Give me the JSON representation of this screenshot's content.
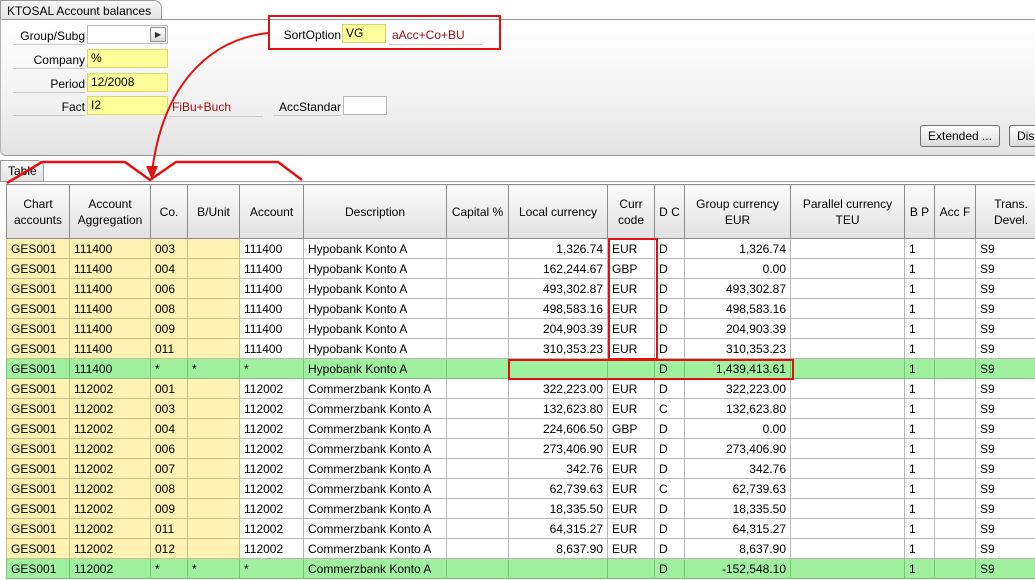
{
  "window": {
    "tab_title": "KTOSAL Account balances"
  },
  "form": {
    "group_subg": {
      "label": "Group/Subg",
      "value": ""
    },
    "company": {
      "label": "Company",
      "value": "%"
    },
    "period": {
      "label": "Period",
      "value": "12/2008"
    },
    "fact": {
      "label": "Fact",
      "value": "I2",
      "hint": "FiBu+Buch"
    },
    "sort_option": {
      "label": "SortOption",
      "value": "VG",
      "hint": "aAcc+Co+BU"
    },
    "acc_standard": {
      "label": "AccStandar",
      "value": ""
    },
    "buttons": {
      "extended": "Extended ...",
      "display": "Dis"
    }
  },
  "table": {
    "tab_label": "Table",
    "headers": [
      "Chart accounts",
      "Account Aggregation",
      "Co.",
      "B/Unit",
      "Account",
      "Description",
      "Capital %",
      "Local currency",
      "Curr code",
      "D C",
      "Group currency EUR",
      "Parallel currency TEU",
      "B P",
      "Acc F",
      "Trans. Devel."
    ],
    "rows": [
      {
        "sum": false,
        "cells": [
          "GES001",
          "111400",
          "003",
          "",
          "111400",
          "Hypobank Konto A",
          "",
          "1,326.74",
          "EUR",
          "D",
          "1,326.74",
          "",
          "1",
          "",
          "S9"
        ]
      },
      {
        "sum": false,
        "cells": [
          "GES001",
          "111400",
          "004",
          "",
          "111400",
          "Hypobank Konto A",
          "",
          "162,244.67",
          "GBP",
          "D",
          "0.00",
          "",
          "1",
          "",
          "S9"
        ]
      },
      {
        "sum": false,
        "cells": [
          "GES001",
          "111400",
          "006",
          "",
          "111400",
          "Hypobank Konto A",
          "",
          "493,302.87",
          "EUR",
          "D",
          "493,302.87",
          "",
          "1",
          "",
          "S9"
        ]
      },
      {
        "sum": false,
        "cells": [
          "GES001",
          "111400",
          "008",
          "",
          "111400",
          "Hypobank Konto A",
          "",
          "498,583.16",
          "EUR",
          "D",
          "498,583.16",
          "",
          "1",
          "",
          "S9"
        ]
      },
      {
        "sum": false,
        "cells": [
          "GES001",
          "111400",
          "009",
          "",
          "111400",
          "Hypobank Konto A",
          "",
          "204,903.39",
          "EUR",
          "D",
          "204,903.39",
          "",
          "1",
          "",
          "S9"
        ]
      },
      {
        "sum": false,
        "cells": [
          "GES001",
          "111400",
          "011",
          "",
          "111400",
          "Hypobank Konto A",
          "",
          "310,353.23",
          "EUR",
          "D",
          "310,353.23",
          "",
          "1",
          "",
          "S9"
        ]
      },
      {
        "sum": true,
        "cells": [
          "GES001",
          "111400",
          "*",
          "*",
          "*",
          "Hypobank Konto A",
          "",
          "",
          "",
          "D",
          "1,439,413.61",
          "",
          "1",
          "",
          "S9"
        ]
      },
      {
        "sum": false,
        "cells": [
          "GES001",
          "112002",
          "001",
          "",
          "112002",
          "Commerzbank Konto A",
          "",
          "322,223.00",
          "EUR",
          "D",
          "322,223.00",
          "",
          "1",
          "",
          "S9"
        ]
      },
      {
        "sum": false,
        "cells": [
          "GES001",
          "112002",
          "003",
          "",
          "112002",
          "Commerzbank Konto A",
          "",
          "132,623.80",
          "EUR",
          "C",
          "132,623.80",
          "",
          "1",
          "",
          "S9"
        ]
      },
      {
        "sum": false,
        "cells": [
          "GES001",
          "112002",
          "004",
          "",
          "112002",
          "Commerzbank Konto A",
          "",
          "224,606.50",
          "GBP",
          "D",
          "0.00",
          "",
          "1",
          "",
          "S9"
        ]
      },
      {
        "sum": false,
        "cells": [
          "GES001",
          "112002",
          "006",
          "",
          "112002",
          "Commerzbank Konto A",
          "",
          "273,406.90",
          "EUR",
          "D",
          "273,406.90",
          "",
          "1",
          "",
          "S9"
        ]
      },
      {
        "sum": false,
        "cells": [
          "GES001",
          "112002",
          "007",
          "",
          "112002",
          "Commerzbank Konto A",
          "",
          "342.76",
          "EUR",
          "D",
          "342.76",
          "",
          "1",
          "",
          "S9"
        ]
      },
      {
        "sum": false,
        "cells": [
          "GES001",
          "112002",
          "008",
          "",
          "112002",
          "Commerzbank Konto A",
          "",
          "62,739.63",
          "EUR",
          "C",
          "62,739.63",
          "",
          "1",
          "",
          "S9"
        ]
      },
      {
        "sum": false,
        "cells": [
          "GES001",
          "112002",
          "009",
          "",
          "112002",
          "Commerzbank Konto A",
          "",
          "18,335.50",
          "EUR",
          "D",
          "18,335.50",
          "",
          "1",
          "",
          "S9"
        ]
      },
      {
        "sum": false,
        "cells": [
          "GES001",
          "112002",
          "011",
          "",
          "112002",
          "Commerzbank Konto A",
          "",
          "64,315.27",
          "EUR",
          "D",
          "64,315.27",
          "",
          "1",
          "",
          "S9"
        ]
      },
      {
        "sum": false,
        "cells": [
          "GES001",
          "112002",
          "012",
          "",
          "112002",
          "Commerzbank Konto A",
          "",
          "8,637.90",
          "EUR",
          "D",
          "8,637.90",
          "",
          "1",
          "",
          "S9"
        ]
      },
      {
        "sum": true,
        "cells": [
          "GES001",
          "112002",
          "*",
          "*",
          "*",
          "Commerzbank Konto A",
          "",
          "",
          "",
          "D",
          "-152,548.10",
          "",
          "1",
          "",
          "S9"
        ]
      }
    ]
  },
  "colors": {
    "highlight_red": "#e41010",
    "input_yellow": "#ffff99",
    "key_column_yellow": "#fff2b3",
    "sum_row_green": "#9ff09f",
    "hint_text": "#a01010"
  },
  "icons": {
    "lookup_button": "play-triangle-icon"
  }
}
